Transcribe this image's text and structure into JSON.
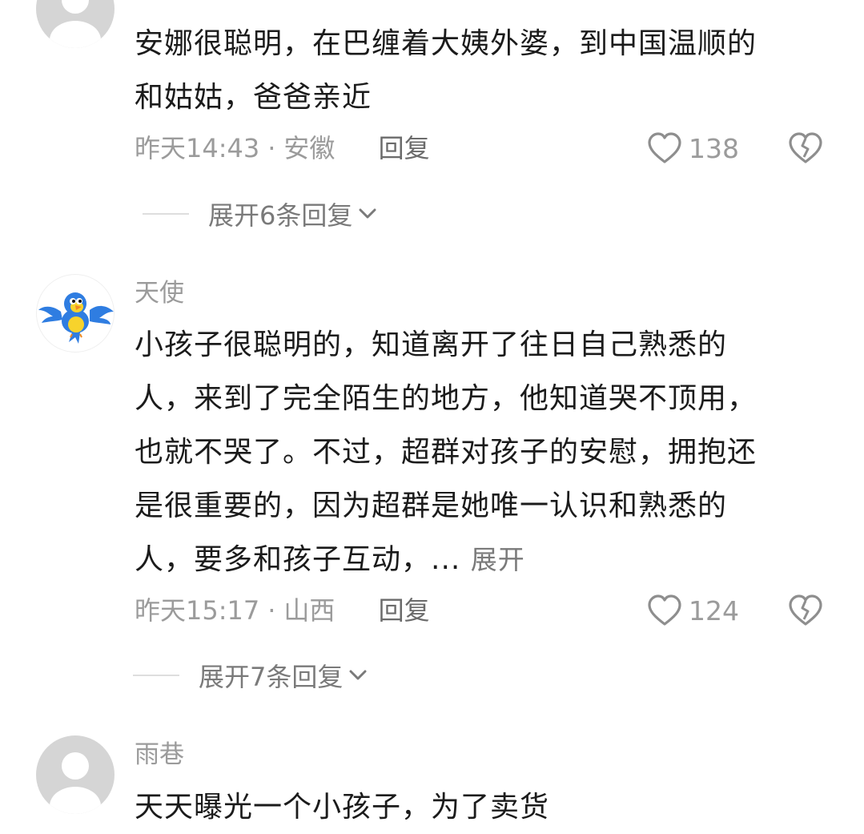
{
  "comments": [
    {
      "username": "",
      "avatar": "default-avatar-icon",
      "content": "安娜很聪明，在巴缠着大姨外婆，到中国温顺的\n和姑姑，爸爸亲近",
      "expand_inline": "",
      "time": "昨天14:43",
      "location": "安徽",
      "reply_label": "回复",
      "likes": "138",
      "expand_replies": "展开6条回复"
    },
    {
      "username": "天使",
      "avatar": "bird-avatar-icon",
      "content": "小孩子很聪明的，知道离开了往日自己熟悉的\n人，来到了完全陌生的地方，他知道哭不顶用，\n也就不哭了。不过，超群对孩子的安慰，拥抱还\n是很重要的，因为超群是她唯一认识和熟悉的\n人，要多和孩子互动，... ",
      "expand_inline": "展开",
      "time": "昨天15:17",
      "location": "山西",
      "reply_label": "回复",
      "likes": "124",
      "expand_replies": "展开7条回复"
    },
    {
      "username": "雨巷",
      "avatar": "default-avatar-icon",
      "content": "天天曝光一个小孩子，为了卖货",
      "expand_inline": ""
    }
  ],
  "separator": "·",
  "colors": {
    "text": "#1b1b1b",
    "muted": "#9b9b9b",
    "secondary": "#6b6b6b",
    "avatar_gray": "#d5d5d5"
  }
}
